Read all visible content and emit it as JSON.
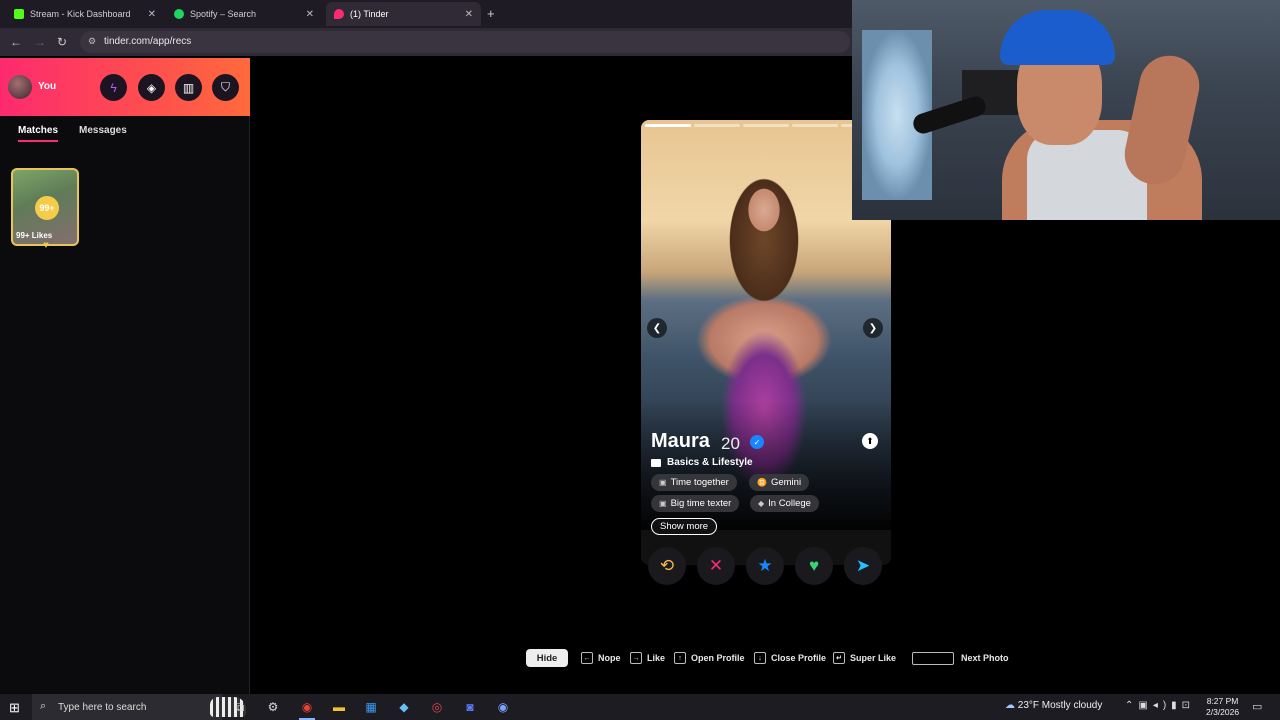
{
  "browser": {
    "tabs": [
      {
        "title": "Stream - Kick Dashboard",
        "favicon_color": "#53fc18",
        "active": false
      },
      {
        "title": "Spotify – Search",
        "favicon_color": "#1ed760",
        "active": false
      },
      {
        "title": "(1) Tinder",
        "favicon_color": "#fd2a6f",
        "active": true
      }
    ],
    "url": "tinder.com/app/recs"
  },
  "sidebar": {
    "user_label": "You",
    "header_buttons": [
      "boost-icon",
      "explore-icon",
      "shop-icon",
      "safety-icon"
    ],
    "tabs": {
      "matches": "Matches",
      "messages": "Messages"
    },
    "likes": {
      "badge": "99+",
      "label": "99+ Likes"
    }
  },
  "profile": {
    "name": "Maura",
    "age": "20",
    "section_label": "Basics & Lifestyle",
    "chips": [
      {
        "icon": "chat-icon",
        "label": "Time together"
      },
      {
        "icon": "zodiac-icon",
        "label": "Gemini"
      },
      {
        "icon": "message-icon",
        "label": "Big time texter"
      },
      {
        "icon": "graduation-icon",
        "label": "In College"
      }
    ],
    "show_more": "Show more",
    "photo_count": 5,
    "current_photo": 1
  },
  "actions": [
    {
      "name": "rewind",
      "glyph": "⟲",
      "color": "#f5b748"
    },
    {
      "name": "nope",
      "glyph": "✕",
      "color": "#fd267d"
    },
    {
      "name": "super-like",
      "glyph": "★",
      "color": "#1786ff"
    },
    {
      "name": "like",
      "glyph": "♥",
      "color": "#3ad37a"
    },
    {
      "name": "boost",
      "glyph": "➤",
      "color": "#21c2ff"
    }
  ],
  "shortcuts": {
    "hide": "Hide",
    "nope": "Nope",
    "like": "Like",
    "open_profile": "Open Profile",
    "close_profile": "Close Profile",
    "super_like": "Super Like",
    "next_photo": "Next Photo"
  },
  "taskbar": {
    "search_placeholder": "Type here to search",
    "weather": "23°F  Mostly cloudy",
    "time": "8:27 PM",
    "date": "2/3/2026"
  }
}
